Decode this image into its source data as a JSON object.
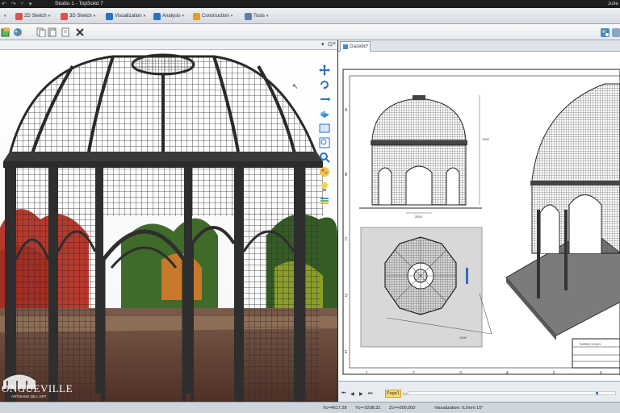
{
  "titlebar": {
    "title": "Studio 1 - TopSolid 7",
    "user": "Julie"
  },
  "menu": {
    "items": [
      {
        "label": "2D Sketch",
        "icon": "sketch-2d-icon",
        "color": "#d9534f"
      },
      {
        "label": "3D Sketch",
        "icon": "sketch-3d-icon",
        "color": "#d9534f"
      },
      {
        "label": "Visualization",
        "icon": "visualization-icon",
        "color": "#2e6fc0"
      },
      {
        "label": "Analysis",
        "icon": "analysis-icon",
        "color": "#2e6fc0"
      },
      {
        "label": "Construction",
        "icon": "construction-icon",
        "color": "#e0a020"
      },
      {
        "label": "Tools",
        "icon": "tools-icon",
        "color": "#5a7fa8"
      }
    ]
  },
  "document": {
    "tab_label": "Gazebo*"
  },
  "drawing": {
    "dimension_labels": [
      "1000",
      "2500",
      "1000"
    ],
    "title_block_company": "TURBO SOLID",
    "row_labels": [
      "A",
      "B",
      "C",
      "D",
      "E"
    ],
    "column_labels": [
      "1",
      "2",
      "3",
      "4",
      "5",
      "6"
    ]
  },
  "page_nav": {
    "page_label": "Page1"
  },
  "watermark": {
    "brand": "ONGUEVILLE",
    "tagline": "ARTISANS DE L'ART"
  },
  "status": {
    "x": "Xc=4617,28",
    "y": "Yc=-5298,31",
    "z": "Zc=+000,000",
    "visualization": "Visualization: 0,2mm 15°"
  },
  "colors": {
    "accent": "#2e6fc0",
    "page_tab": "#ffd86b"
  }
}
